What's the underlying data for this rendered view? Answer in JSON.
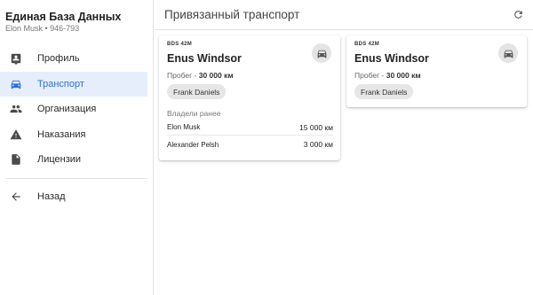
{
  "brand": {
    "title": "Единая База Данных",
    "subtitle": "Elon Musk • 946-793"
  },
  "nav": [
    {
      "label": "Профиль",
      "icon": "profile-icon",
      "active": false
    },
    {
      "label": "Транспорт",
      "icon": "car-icon",
      "active": true
    },
    {
      "label": "Организация",
      "icon": "people-icon",
      "active": false
    },
    {
      "label": "Наказания",
      "icon": "warning-icon",
      "active": false
    },
    {
      "label": "Лицензии",
      "icon": "document-icon",
      "active": false
    }
  ],
  "back": {
    "label": "Назад",
    "icon": "arrow-left-icon"
  },
  "header": {
    "title": "Привязанный транспорт",
    "refresh_icon": "refresh-icon"
  },
  "accent_color": "#2f6fd8",
  "vehicles": [
    {
      "plate": "BDS 42M",
      "model": "Enus Windsor",
      "mileage_label": "Пробег - ",
      "mileage_value": "30 000 км",
      "owner": "Frank Daniels",
      "previous_title": "Владели ранее",
      "previous_owners": [
        {
          "name": "Elon Musk",
          "amount": "15 000 км"
        },
        {
          "name": "Alexander Pelsh",
          "amount": "3 000 км"
        }
      ]
    },
    {
      "plate": "BDS 42M",
      "model": "Enus Windsor",
      "mileage_label": "Пробег - ",
      "mileage_value": "30 000 км",
      "owner": "Frank Daniels"
    }
  ]
}
